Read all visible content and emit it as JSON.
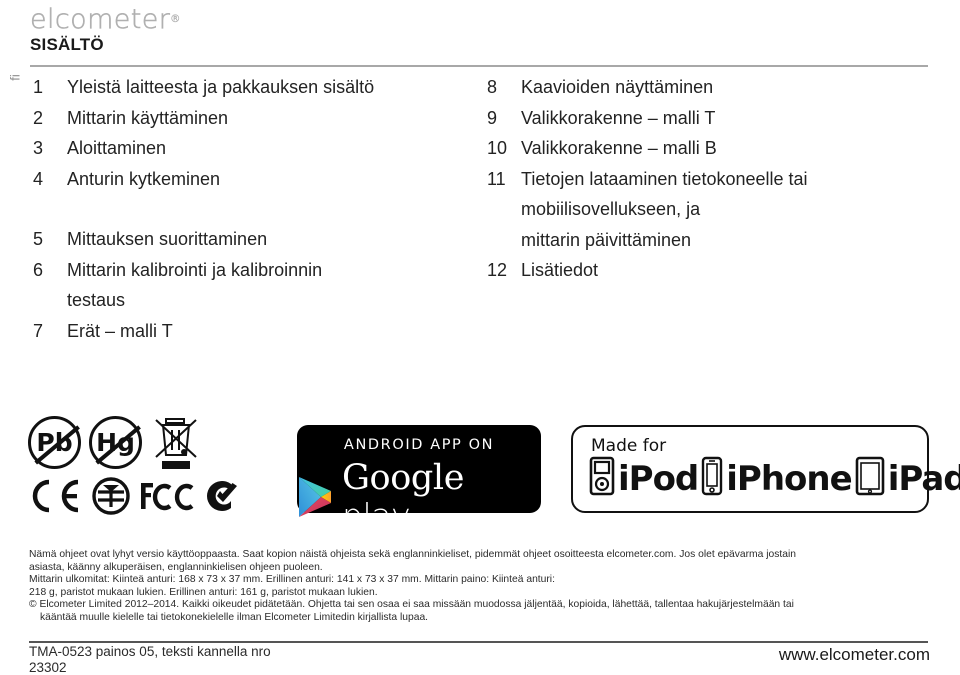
{
  "brand": {
    "logo_text": "elcometer",
    "logo_registered": "®",
    "language_tag": "fi"
  },
  "header": {
    "title": "SISÄLTÖ"
  },
  "toc": {
    "left_column": [
      {
        "num": "1",
        "label": "Yleistä laitteesta ja pakkauksen sisältö"
      },
      {
        "num": "2",
        "label": "Mittarin käyttäminen"
      },
      {
        "num": "3",
        "label": "Aloittaminen"
      },
      {
        "num": "4",
        "label": "Anturin kytkeminen"
      },
      {
        "num": "5",
        "label": "Mittauksen suorittaminen",
        "gap_before": true
      },
      {
        "num": "6",
        "label": "Mittarin kalibrointi ja kalibroinnin",
        "continuation": "testaus"
      },
      {
        "num": "7",
        "label": "Erät – malli T"
      }
    ],
    "right_column": [
      {
        "num": "8",
        "label": "Kaavioiden näyttäminen"
      },
      {
        "num": "9",
        "label": "Valikkorakenne – malli T"
      },
      {
        "num": "10",
        "label": "Valikkorakenne – malli B"
      },
      {
        "num": "11",
        "label": "Tietojen lataaminen tietokoneelle tai mobiilisovellukseen, ja",
        "continuation": "mittarin päivittäminen"
      },
      {
        "num": "12",
        "label": "Lisätiedot"
      }
    ]
  },
  "compliance": {
    "pb_label": "Pb",
    "hg_label": "Hg",
    "icons": [
      "no-lead-icon",
      "no-mercury-icon",
      "weee-bin-icon",
      "ce-mark-icon",
      "tuv-mark-icon",
      "fcc-mark-icon",
      "c-tick-mark-icon"
    ]
  },
  "google_play": {
    "top_text": "ANDROID APP ON",
    "word_google": "Google",
    "word_play": "play"
  },
  "made_for_apple": {
    "made_for": "Made for",
    "ipod": "iPod",
    "iphone": "iPhone",
    "ipad": "iPad"
  },
  "fineprint": {
    "line1": "Nämä ohjeet ovat lyhyt versio käyttöoppaasta. Saat kopion näistä ohjeista sekä englanninkieliset, pidemmät ohjeet osoitteesta elcometer.com. Jos olet epävarma jostain",
    "line2": "asiasta, käänny alkuperäisen, englanninkielisen ohjeen puoleen.",
    "line3": "Mittarin ulkomitat: Kiinteä anturi: 168 x 73 x 37 mm. Erillinen anturi: 141 x 73 x 37 mm. Mittarin paino: Kiinteä anturi:",
    "line4": "218 g, paristot mukaan lukien. Erillinen anturi: 161 g, paristot mukaan lukien.",
    "line5": "© Elcometer Limited 2012–2014. Kaikki oikeudet pidätetään. Ohjetta tai sen osaa ei saa missään muodossa jäljentää, kopioida, lähettää, tallentaa hakujärjestelmään tai",
    "line6": "kääntää muulle kielelle tai tietokonekielelle ilman Elcometer Limitedin kirjallista lupaa."
  },
  "footer": {
    "doc_code": "TMA-0523 painos 05, teksti kannella nro",
    "doc_number": "23302",
    "website": "www.elcometer.com"
  }
}
